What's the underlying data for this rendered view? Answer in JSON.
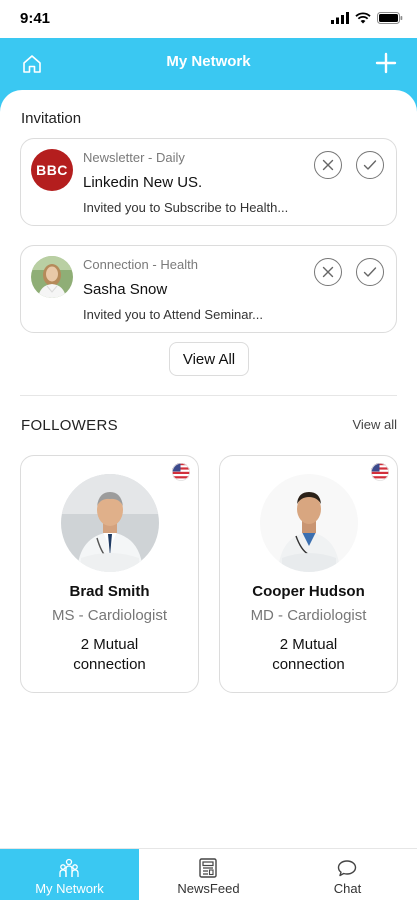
{
  "status_bar": {
    "time": "9:41"
  },
  "header": {
    "title": "My Network"
  },
  "invitation": {
    "section_title": "Invitation",
    "items": [
      {
        "type": "Newsletter",
        "category": "Daily",
        "name": "Linkedin New US.",
        "description": "Invited you to Subscribe to Health...",
        "avatar_text": "BBC",
        "avatar_color": "#b41e1e"
      },
      {
        "type": "Connection",
        "category": "Health",
        "name": "Sasha Snow",
        "description": "Invited you to Attend Seminar..."
      }
    ],
    "view_all_label": "View All"
  },
  "followers": {
    "section_title": "FOLLOWERS",
    "view_all_label": "View all",
    "items": [
      {
        "name": "Brad Smith",
        "role": "MS - Cardiologist",
        "mutual": "2 Mutual connection",
        "flag": "us-flag-icon"
      },
      {
        "name": "Cooper Hudson",
        "role": "MD - Cardiologist",
        "mutual": "2 Mutual connection",
        "flag": "us-flag-icon"
      }
    ]
  },
  "bottom_nav": {
    "items": [
      {
        "label": "My Network",
        "icon": "network-icon",
        "active": true
      },
      {
        "label": "NewsFeed",
        "icon": "newsfeed-icon",
        "active": false
      },
      {
        "label": "Chat",
        "icon": "chat-icon",
        "active": false
      }
    ]
  },
  "colors": {
    "accent": "#3ac8f2",
    "card_border": "#dcdcdc",
    "muted_text": "#7a7a7a"
  }
}
